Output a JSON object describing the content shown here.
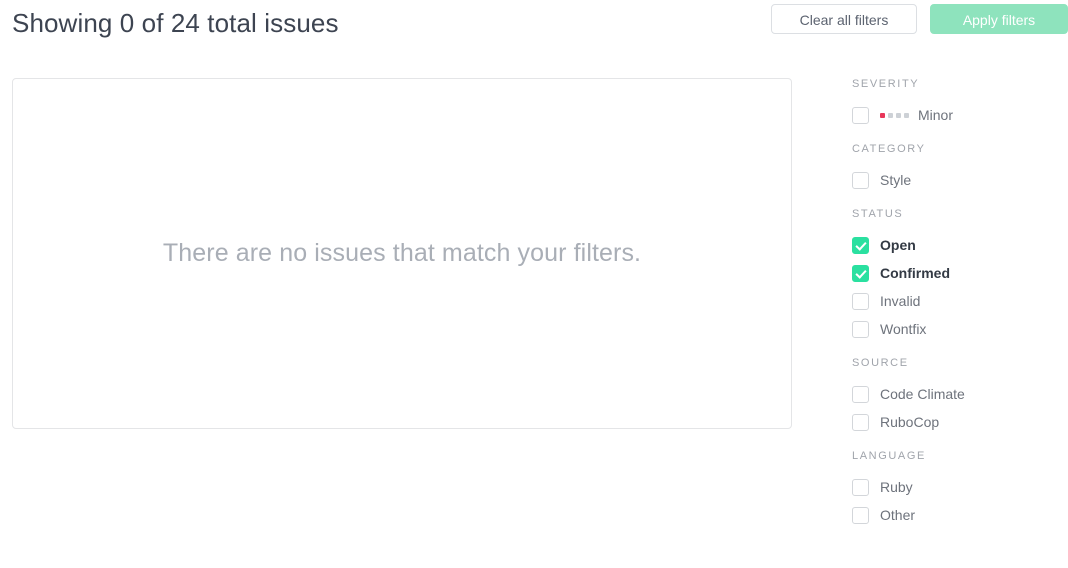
{
  "header": {
    "title": "Showing 0 of 24 total issues",
    "clear_label": "Clear all filters",
    "apply_label": "Apply filters"
  },
  "main": {
    "empty_message": "There are no issues that match your filters."
  },
  "colors": {
    "accent_green": "#2ae0a0",
    "apply_button_green": "#8ee3bd",
    "severity_minor_dot": "#e8375a",
    "dot_inactive": "#cdd1d6",
    "panel_border": "#e4e5e7"
  },
  "filters": {
    "groups": [
      {
        "title": "SEVERITY",
        "items": [
          {
            "label": "Minor",
            "checked": false,
            "dots_total": 4,
            "dots_active": 1
          }
        ]
      },
      {
        "title": "CATEGORY",
        "items": [
          {
            "label": "Style",
            "checked": false
          }
        ]
      },
      {
        "title": "STATUS",
        "items": [
          {
            "label": "Open",
            "checked": true
          },
          {
            "label": "Confirmed",
            "checked": true
          },
          {
            "label": "Invalid",
            "checked": false
          },
          {
            "label": "Wontfix",
            "checked": false
          }
        ]
      },
      {
        "title": "SOURCE",
        "items": [
          {
            "label": "Code Climate",
            "checked": false
          },
          {
            "label": "RuboCop",
            "checked": false
          }
        ]
      },
      {
        "title": "LANGUAGE",
        "items": [
          {
            "label": "Ruby",
            "checked": false
          },
          {
            "label": "Other",
            "checked": false
          }
        ]
      }
    ]
  }
}
